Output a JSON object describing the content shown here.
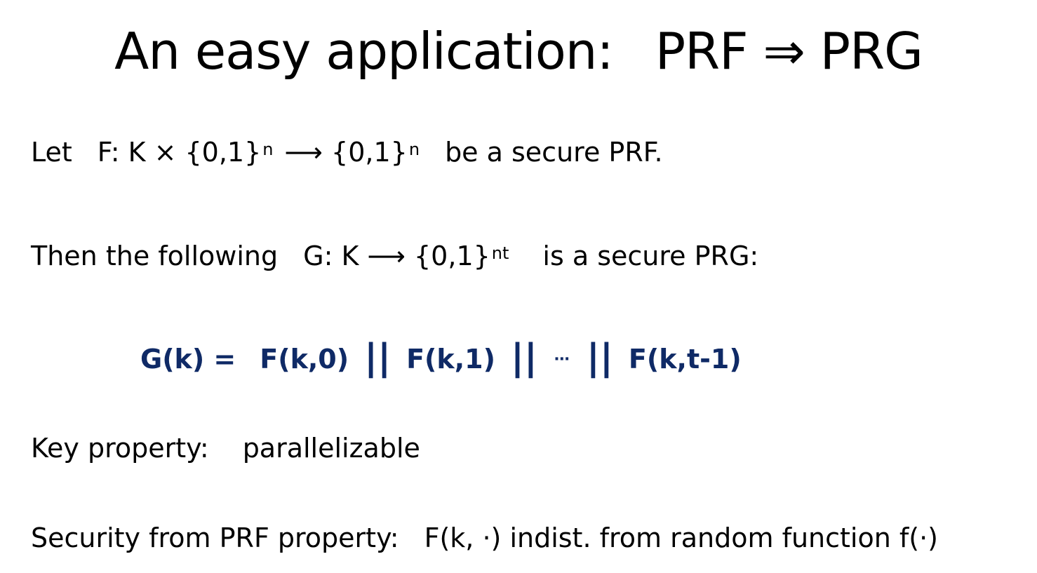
{
  "title": {
    "left": "An easy application:",
    "right": "PRF ⇒ PRG"
  },
  "line1": {
    "let": "Let",
    "def": "F: K × {0,1}",
    "exp1": "n",
    "arrow": "⟶ {0,1}",
    "exp2": "n",
    "tail": "be  a secure PRF."
  },
  "line2": {
    "intro": "Then the following",
    "def": "G: K ⟶ {0,1}",
    "exp": "nt",
    "tail": "is a secure PRG:"
  },
  "formula": {
    "lhs": "G(k) =",
    "t0": "F(k,0)",
    "sep": "||",
    "t1": "F(k,1)",
    "dots": "⋯",
    "tlast": "F(k,t-1)",
    "color": "#0f2a66"
  },
  "line3": {
    "label": "Key property:",
    "value": "parallelizable"
  },
  "line4": {
    "label": "Security from PRF property:",
    "value": "F(k, ⋅)  indist. from random function f(⋅)"
  }
}
